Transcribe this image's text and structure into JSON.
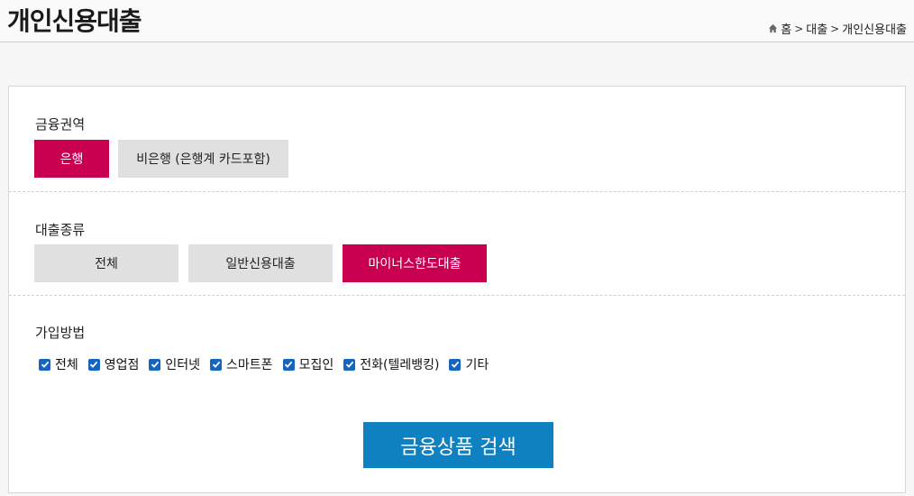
{
  "header": {
    "title": "개인신용대출",
    "breadcrumb": {
      "home": "홈",
      "sep": ">",
      "level1": "대출",
      "level2": "개인신용대출"
    }
  },
  "filters": {
    "area": {
      "label": "금융권역",
      "options": [
        {
          "label": "은행",
          "selected": true
        },
        {
          "label": "비은행 (은행계 카드포함)",
          "selected": false
        }
      ]
    },
    "loan_type": {
      "label": "대출종류",
      "options": [
        {
          "label": "전체",
          "selected": false
        },
        {
          "label": "일반신용대출",
          "selected": false
        },
        {
          "label": "마이너스한도대출",
          "selected": true
        }
      ]
    },
    "join_method": {
      "label": "가입방법",
      "options": [
        {
          "label": "전체",
          "checked": true
        },
        {
          "label": "영업점",
          "checked": true
        },
        {
          "label": "인터넷",
          "checked": true
        },
        {
          "label": "스마트폰",
          "checked": true
        },
        {
          "label": "모집인",
          "checked": true
        },
        {
          "label": "전화(텔레뱅킹)",
          "checked": true
        },
        {
          "label": "기타",
          "checked": true
        }
      ]
    }
  },
  "search_button": "금융상품 검색",
  "colors": {
    "active": "#c8004f",
    "inactive": "#e0e0e0",
    "search": "#0f80c0",
    "checkbox": "#1565c0"
  }
}
